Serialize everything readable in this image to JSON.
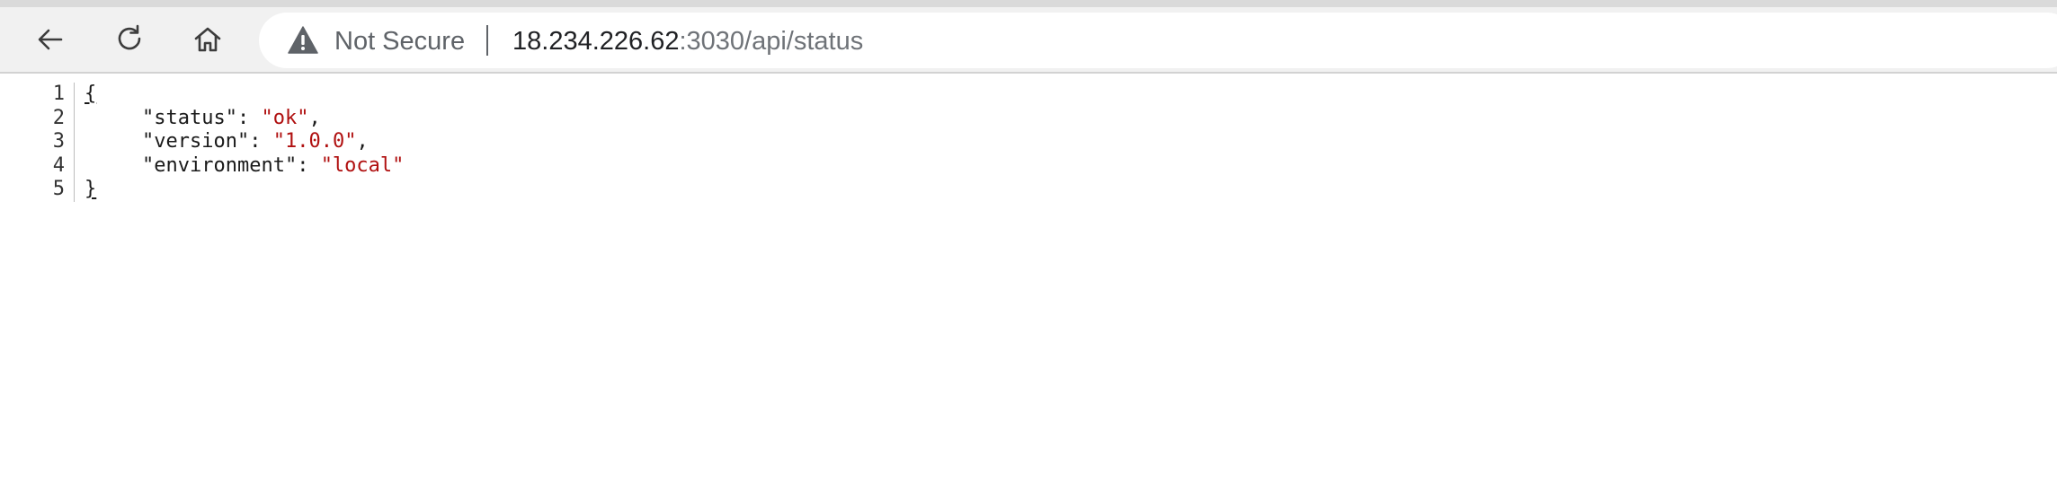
{
  "browser": {
    "nav": {
      "back_icon": "back-arrow-icon",
      "reload_icon": "reload-icon",
      "home_icon": "home-icon"
    },
    "address_bar": {
      "security_icon": "warning-triangle-icon",
      "security_label": "Not Secure",
      "url_host": "18.234.226.62",
      "url_rest": ":3030/api/status"
    }
  },
  "json_view": {
    "line_numbers": [
      "1",
      "2",
      "3",
      "4",
      "5"
    ],
    "open_brace": "{",
    "close_brace": "}",
    "entries": [
      {
        "key": "\"status\"",
        "value": "\"ok\"",
        "trailing": ","
      },
      {
        "key": "\"version\"",
        "value": "\"1.0.0\"",
        "trailing": ","
      },
      {
        "key": "\"environment\"",
        "value": "\"local\"",
        "trailing": ""
      }
    ]
  },
  "colors": {
    "string_value": "#b01010",
    "toolbar_bg": "#f1f1f1"
  }
}
